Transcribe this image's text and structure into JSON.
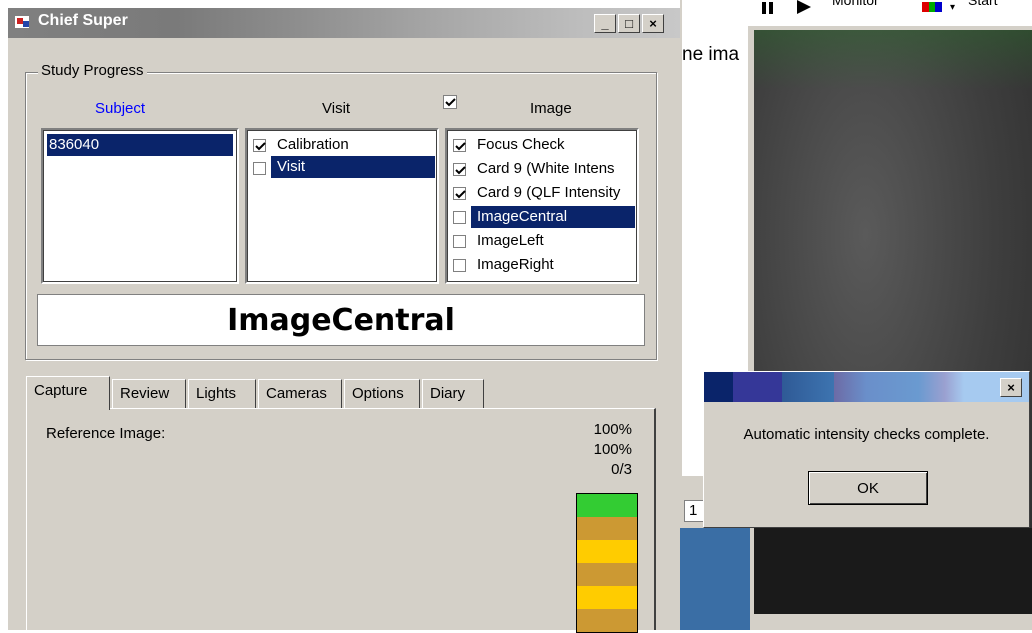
{
  "window": {
    "title": "Chief Super",
    "controls": {
      "minimize": "_",
      "maximize": "□",
      "close": "×"
    }
  },
  "study_progress": {
    "legend": "Study Progress",
    "subject_header": "Subject",
    "visit_header": "Visit",
    "image_header": "Image",
    "image_header_checked": true,
    "subjects": [
      {
        "label": "836040",
        "selected": true
      }
    ],
    "visits": [
      {
        "label": "Calibration",
        "checked": true,
        "selected": false
      },
      {
        "label": "Visit",
        "checked": false,
        "selected": true
      }
    ],
    "images": [
      {
        "label": "Focus Check",
        "checked": true,
        "selected": false
      },
      {
        "label": "Card 9 (White Intens",
        "checked": true,
        "selected": false
      },
      {
        "label": "Card 9 (QLF Intensity",
        "checked": true,
        "selected": false
      },
      {
        "label": "ImageCentral",
        "checked": false,
        "selected": true
      },
      {
        "label": "ImageLeft",
        "checked": false,
        "selected": false
      },
      {
        "label": "ImageRight",
        "checked": false,
        "selected": false
      }
    ],
    "current_image": "ImageCentral"
  },
  "tabs": [
    {
      "label": "Capture",
      "active": true
    },
    {
      "label": "Review",
      "active": false
    },
    {
      "label": "Lights",
      "active": false
    },
    {
      "label": "Cameras",
      "active": false
    },
    {
      "label": "Options",
      "active": false
    },
    {
      "label": "Diary",
      "active": false
    }
  ],
  "capture": {
    "reference_label": "Reference Image:",
    "stat1": "100%",
    "stat2": "100%",
    "stat3": "0/3",
    "meter_segment_colors": [
      "#33cc33",
      "#cc9933",
      "#ffcc00",
      "#cc9933",
      "#ffcc00",
      "#cc9933"
    ]
  },
  "background": {
    "partial_text": "ne ima",
    "monitor_label": "Monitor",
    "start_label": "Start",
    "edge_digit": "1"
  },
  "dialog": {
    "message": "Automatic intensity checks complete.",
    "ok_label": "OK",
    "close": "×"
  }
}
